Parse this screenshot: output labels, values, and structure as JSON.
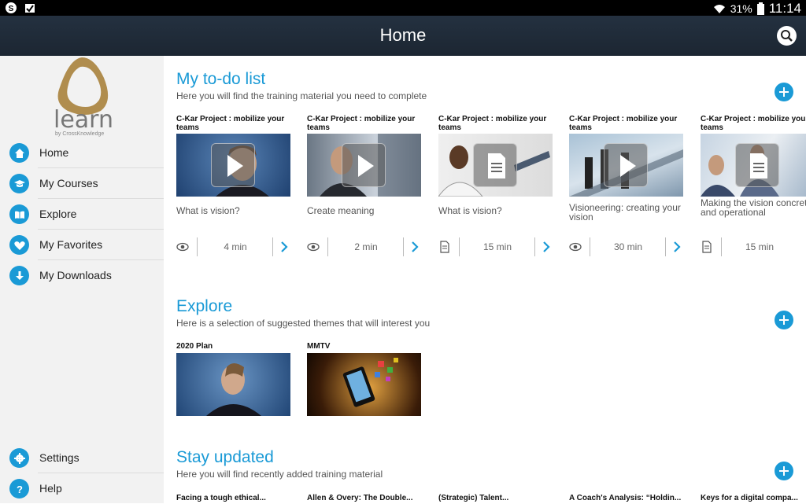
{
  "status": {
    "battery": "31%",
    "time": "11:14"
  },
  "appbar": {
    "title": "Home",
    "search_icon": "search-icon"
  },
  "logo": {
    "word": "learn",
    "sub": "by CrossKnowledge"
  },
  "sidebar": {
    "items": [
      {
        "label": "Home",
        "icon": "home-icon"
      },
      {
        "label": "My Courses",
        "icon": "graduation-cap-icon"
      },
      {
        "label": "Explore",
        "icon": "book-icon"
      },
      {
        "label": "My Favorites",
        "icon": "heart-icon"
      },
      {
        "label": "My Downloads",
        "icon": "download-icon"
      }
    ],
    "bottom": [
      {
        "label": "Settings",
        "icon": "gear-icon"
      },
      {
        "label": "Help",
        "icon": "help-icon"
      }
    ]
  },
  "todo": {
    "title": "My to-do list",
    "subtitle": "Here you will find the training material you need to complete",
    "cards": [
      {
        "title": "C-Kar Project : mobilize your teams",
        "caption": "What is vision?",
        "duration": "4 min",
        "kind": "video"
      },
      {
        "title": "C-Kar Project : mobilize your teams",
        "caption": "Create meaning",
        "duration": "2 min",
        "kind": "video"
      },
      {
        "title": "C-Kar Project : mobilize your teams",
        "caption": "What is vision?",
        "duration": "15 min",
        "kind": "document"
      },
      {
        "title": "C-Kar Project : mobilize your teams",
        "caption": "Visioneering: creating your vision",
        "duration": "30 min",
        "kind": "video"
      },
      {
        "title": "C-Kar Project : mobilize your teams",
        "caption": "Making the vision concrete and operational",
        "duration": "15 min",
        "kind": "document"
      }
    ]
  },
  "explore": {
    "title": "Explore",
    "subtitle": "Here is a selection of suggested themes that will interest you",
    "cards": [
      {
        "title": "2020 Plan"
      },
      {
        "title": "MMTV"
      }
    ]
  },
  "updated": {
    "title": "Stay updated",
    "subtitle": "Here you will find recently added training material",
    "cards": [
      {
        "title": "Facing a tough ethical..."
      },
      {
        "title": "Allen & Overy: The Double..."
      },
      {
        "title": "(Strategic) Talent..."
      },
      {
        "title": "A Coach's Analysis: “Holdin..."
      },
      {
        "title": "Keys for a digital compa..."
      }
    ]
  },
  "colors": {
    "accent": "#1a9ad6",
    "appbar": "#1f2a36"
  }
}
